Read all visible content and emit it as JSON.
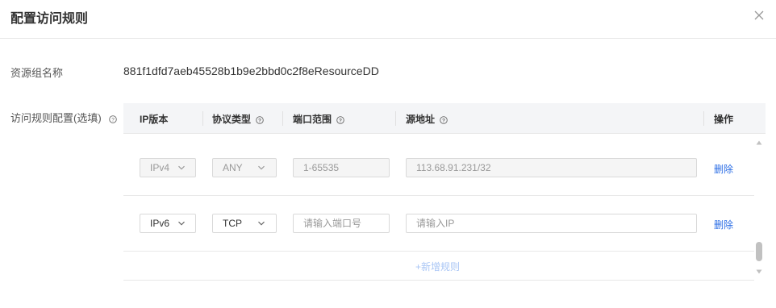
{
  "dialog": {
    "title": "配置访问规则"
  },
  "form": {
    "resource_group_label": "资源组名称",
    "resource_group_value": "881f1dfd7aeb45528b1b9e2bbd0c2f8eResourceDD",
    "rules_label": "访问规则配置(选填)"
  },
  "table": {
    "headers": {
      "ip_version": "IP版本",
      "protocol": "协议类型",
      "port_range": "端口范围",
      "source": "源地址",
      "action": "操作"
    },
    "rows": [
      {
        "ip_version": "IPv4",
        "protocol": "ANY",
        "port_range": "1-65535",
        "source": "113.68.91.231/32",
        "action": "删除",
        "disabled": true
      },
      {
        "ip_version": "IPv6",
        "protocol": "TCP",
        "port_placeholder": "请输入端口号",
        "source_placeholder": "请输入IP",
        "action": "删除",
        "disabled": false
      }
    ],
    "add_rule": "+新增规则"
  },
  "icons": {
    "close": "close-icon",
    "help": "question-circle-icon",
    "dropdown": "chevron-down-icon"
  },
  "colors": {
    "link": "#2b6de5",
    "add_link": "#a8c5f5",
    "header_bg": "#f4f5f7"
  }
}
